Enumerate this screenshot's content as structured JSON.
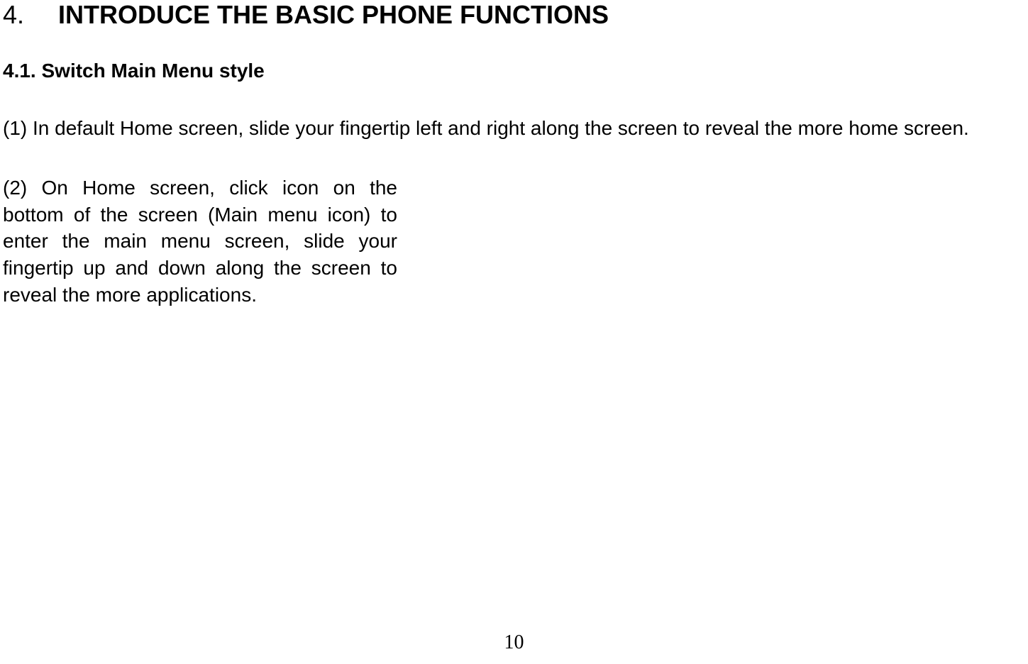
{
  "section": {
    "number": "4.",
    "title": "INTRODUCE THE BASIC PHONE FUNCTIONS"
  },
  "subsection": {
    "heading": "4.1. Switch Main Menu style"
  },
  "paragraphs": {
    "p1": "(1) In default Home screen, slide your fingertip left and right along the screen to reveal the more home screen.",
    "p2": "(2) On Home screen, click icon on the bottom of the screen (Main menu icon) to enter the main menu screen, slide your fingertip up and down along the screen to reveal the more applications."
  },
  "page_number": "10"
}
